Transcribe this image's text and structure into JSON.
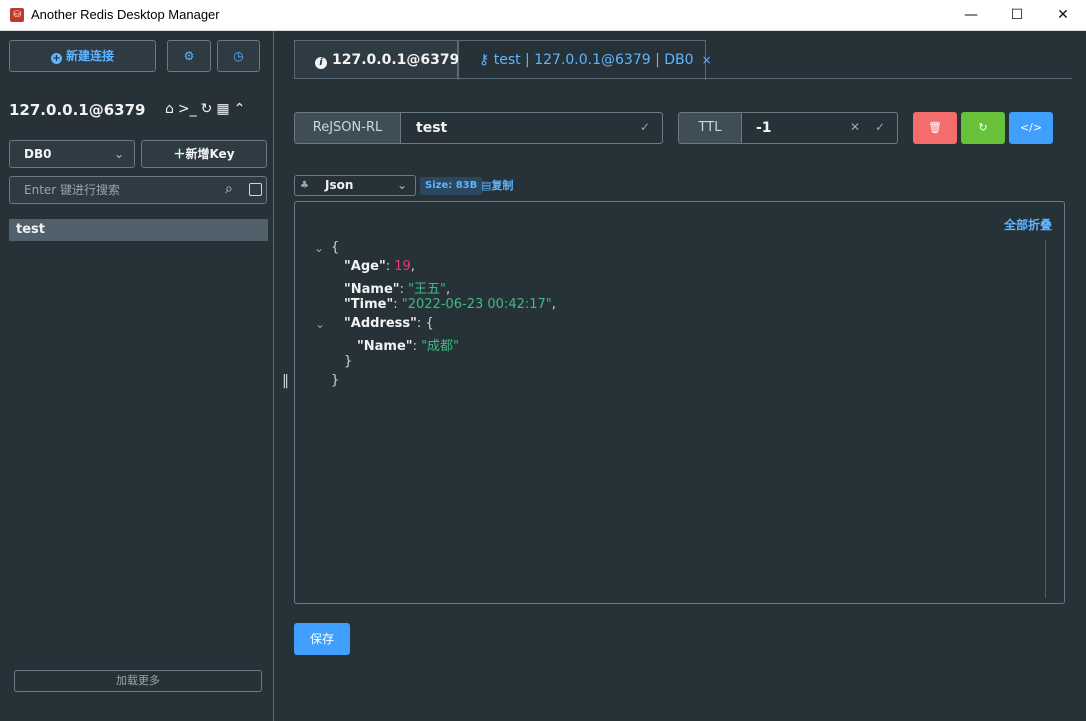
{
  "window": {
    "title": "Another Redis Desktop Manager",
    "app_icon": "redis-logo-icon",
    "minimize": "—",
    "maximize": "☐",
    "close": "✕"
  },
  "sidebar": {
    "new_connection_label": "新建连接",
    "settings_icon": "gear-icon",
    "history_icon": "clock-icon",
    "connection_name": "127.0.0.1@6379",
    "connection_icons": [
      "home-icon",
      "terminal-icon",
      "refresh-icon",
      "grid-icon",
      "chevron-up-icon"
    ],
    "db_selected": "DB0",
    "new_key_label": "新增Key",
    "search_placeholder": "Enter 键进行搜索",
    "keys": [
      "test"
    ],
    "load_more_label": "加载更多"
  },
  "tabs": [
    {
      "label": "127.0.0.1@6379",
      "icon": "info-icon",
      "active": false
    },
    {
      "label": "test | 127.0.0.1@6379 | DB0",
      "icon": "key-icon",
      "active": true
    }
  ],
  "key_header": {
    "type": "ReJSON-RL",
    "key_name": "test",
    "ttl_label": "TTL",
    "ttl_value": "-1"
  },
  "viewer": {
    "format": "Json",
    "size": "Size: 83B",
    "copy_label": "复制",
    "collapse_all_label": "全部折叠"
  },
  "json_lines": {
    "open": "{",
    "age_key": "\"Age\"",
    "age_val": "19",
    "name_key": "\"Name\"",
    "name_val": "\"王五\"",
    "time_key": "\"Time\"",
    "time_val": "\"2022-06-23 00:42:17\"",
    "address_key": "\"Address\"",
    "address_open": "{",
    "addr_name_key": "\"Name\"",
    "addr_name_val": "\"成都\"",
    "address_close": "}",
    "close": "}"
  },
  "save_label": "保存",
  "colors": {
    "accent": "#409eff",
    "delete": "#f56c6c",
    "refresh": "#67c23a",
    "background": "#263238",
    "json_number": "#f0347c",
    "json_string": "#42b883"
  }
}
